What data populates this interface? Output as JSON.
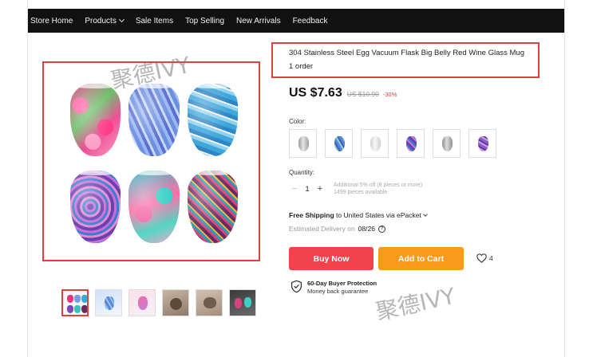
{
  "nav": {
    "items": [
      {
        "label": "Store Home"
      },
      {
        "label": "Products",
        "has_dropdown": true
      },
      {
        "label": "Sale Items"
      },
      {
        "label": "Top Selling"
      },
      {
        "label": "New Arrivals"
      },
      {
        "label": "Feedback"
      }
    ]
  },
  "product": {
    "title": "304 Stainless Steel Egg Vacuum Flask Big Belly Red Wine Glass Mug",
    "orders": "1 order",
    "price_current": "US $7.63",
    "price_original": "US $10.90",
    "discount": "-30%"
  },
  "color": {
    "label": "Color:",
    "swatches": [
      {
        "name": "silver"
      },
      {
        "name": "blue-peacock"
      },
      {
        "name": "white"
      },
      {
        "name": "purple-mandala"
      },
      {
        "name": "gray"
      },
      {
        "name": "lilac-print"
      }
    ]
  },
  "quantity": {
    "label": "Quantity:",
    "minus": "−",
    "value": "1",
    "plus": "+",
    "note_line1": "Additional 5% off (8 pieces or more)",
    "note_line2": "1499 pieces available"
  },
  "shipping": {
    "free": "Free Shipping",
    "rest": "to United States via ePacket",
    "delivery_label": "Estimated Delivery on",
    "delivery_date": "08/26",
    "help_icon": "?"
  },
  "actions": {
    "buy_now": "Buy Now",
    "add_to_cart": "Add to Cart",
    "wishlist_count": "4"
  },
  "protection": {
    "title": "60-Day Buyer Protection",
    "subtitle": "Money back guarantee"
  },
  "watermark": {
    "text_1": "聚德IVY",
    "text_2": "聚德IVY"
  },
  "colors": {
    "accent_red": "#f0434b",
    "cart_orange": "#f99a1c",
    "highlight_border": "#e04040",
    "nav_bg": "#111111"
  },
  "icons": {
    "wishlist": "heart-icon",
    "protection": "shield-check-icon",
    "delivery_help": "question-circle-icon",
    "products_dropdown": "chevron-down-icon"
  }
}
